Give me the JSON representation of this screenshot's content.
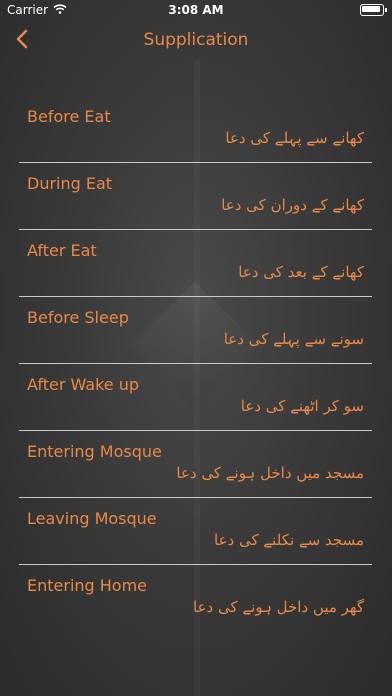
{
  "status_bar": {
    "carrier": "Carrier",
    "time": "3:08 AM"
  },
  "nav": {
    "back_icon": "chevron-left-icon",
    "title": "Supplication"
  },
  "colors": {
    "accent": "#e8894a",
    "separator": "#c9c9c9",
    "background": "#3a3a3a"
  },
  "items": [
    {
      "label": "Before Eat",
      "urdu": "کھانے سے پہلے کی دعا"
    },
    {
      "label": "During Eat",
      "urdu": "کھانے کے دوران کی دعا"
    },
    {
      "label": "After Eat",
      "urdu": "کھانے کے بعد کی دعا"
    },
    {
      "label": "Before Sleep",
      "urdu": "سونے سے پہلے کی دعا"
    },
    {
      "label": "After Wake up",
      "urdu": "سو کر اٹھنے کی دعا"
    },
    {
      "label": "Entering Mosque",
      "urdu": "مسجد میں داخل ہونے کی دعا"
    },
    {
      "label": "Leaving Mosque",
      "urdu": "مسجد سے نکلنے کی دعا"
    },
    {
      "label": "Entering Home",
      "urdu": "گھر میں داخل ہونے کی دعا"
    }
  ]
}
